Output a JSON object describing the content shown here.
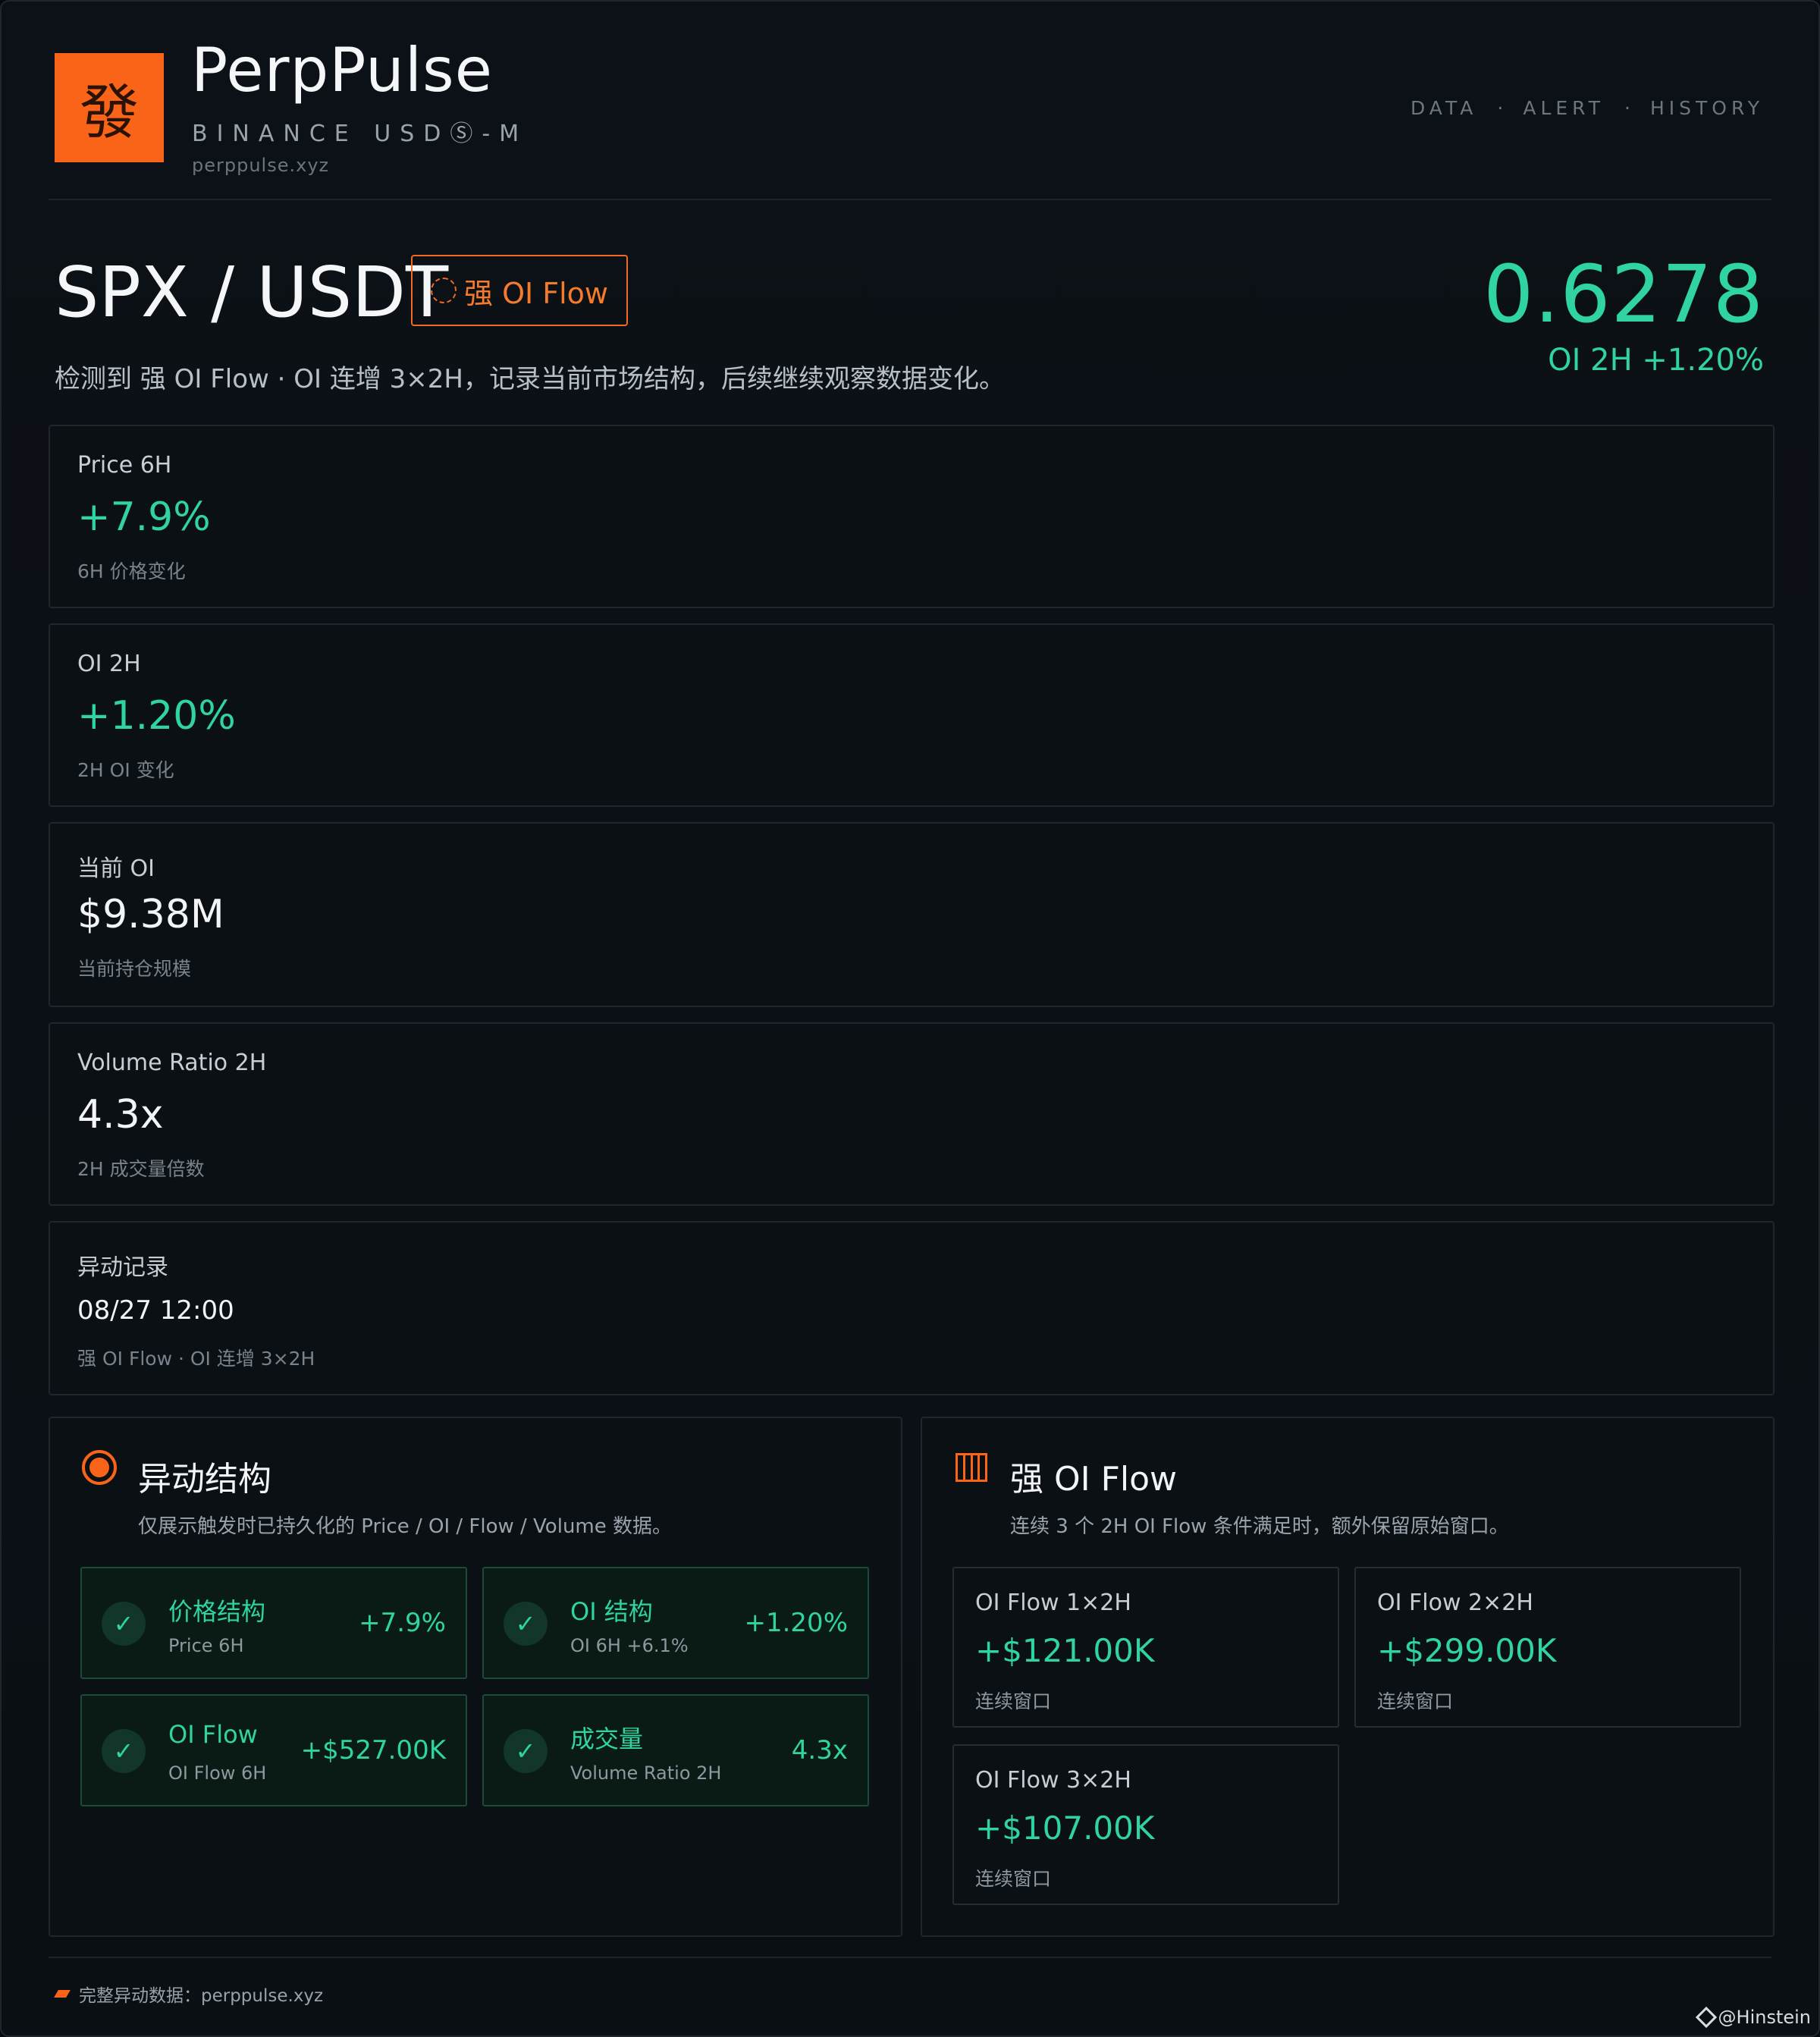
{
  "brand": {
    "logo_char": "發",
    "title": "PerpPulse",
    "subtitle": "BINANCE USDⓈ-M",
    "url": "perppulse.xyz"
  },
  "nav": [
    "DATA",
    "ALERT",
    "HISTORY"
  ],
  "nav_separator": "·",
  "pair": {
    "symbol": "SPX / USDT",
    "badge": "强 OI Flow",
    "price": "0.6278",
    "price_sub": "OI 2H +1.20%",
    "description": "检测到 强 OI Flow · OI 连增 3×2H，记录当前市场结构，后续继续观察数据变化。"
  },
  "metrics": [
    {
      "label": "Price 6H",
      "value": "+7.9%",
      "note": "6H 价格变化"
    },
    {
      "label": "OI 2H",
      "value": "+1.20%",
      "note": "2H OI 变化"
    },
    {
      "label": "当前 OI",
      "value": "$9.38M",
      "note": "当前持仓规模"
    },
    {
      "label": "Volume Ratio 2H",
      "value": "4.3x",
      "note": "2H 成交量倍数"
    },
    {
      "label": "异动记录",
      "value": "08/27 12:00",
      "note": "强 OI Flow · OI 连增 3×2H"
    }
  ],
  "structure_panel": {
    "title": "异动结构",
    "description": "仅展示触发时已持久化的 Price / OI / Flow / Volume 数据。",
    "check_glyph": "✓",
    "tiles": [
      {
        "title": "价格结构",
        "sub": "Price 6H",
        "value": "+7.9%"
      },
      {
        "title": "OI 结构",
        "sub": "OI 6H +6.1%",
        "value": "+1.20%"
      },
      {
        "title": "OI Flow",
        "sub": "OI Flow 6H",
        "value": "+$527.00K"
      },
      {
        "title": "成交量",
        "sub": "Volume Ratio 2H",
        "value": "4.3x"
      }
    ]
  },
  "flow_panel": {
    "title": "强 OI Flow",
    "description": "连续 3 个 2H OI Flow 条件满足时，额外保留原始窗口。",
    "cards": [
      {
        "label": "OI Flow 1×2H",
        "value": "+$121.00K",
        "note": "连续窗口"
      },
      {
        "label": "OI Flow 2×2H",
        "value": "+$299.00K",
        "note": "连续窗口"
      },
      {
        "label": "OI Flow 3×2H",
        "value": "+$107.00K",
        "note": "连续窗口"
      }
    ]
  },
  "footer": {
    "text": "完整异动数据：perppulse.xyz"
  },
  "watermark": "@Hinstein",
  "colors": {
    "accent": "#fa6418",
    "green": "#2fd4a0",
    "background": "#0a0f14"
  }
}
